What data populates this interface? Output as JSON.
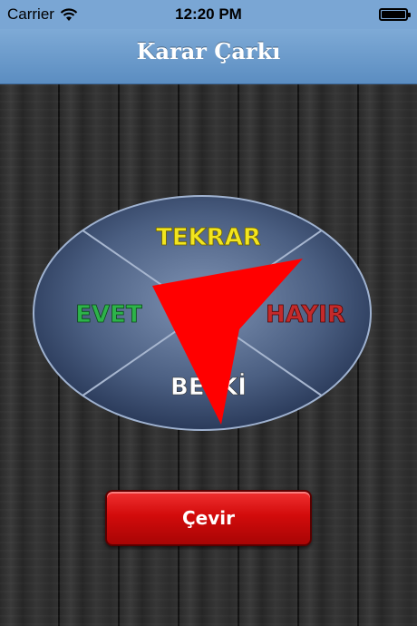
{
  "status_bar": {
    "carrier": "Carrier",
    "time": "12:20 PM",
    "wifi_icon": "wifi-icon",
    "battery_icon": "battery-icon"
  },
  "nav": {
    "title": "Karar Çarkı"
  },
  "wheel": {
    "segments": {
      "top": "TEKRAR",
      "left": "EVET",
      "right": "HAYIR",
      "bottom": "BELKİ"
    },
    "colors": {
      "top": "#f2e51e",
      "left": "#2db34a",
      "right": "#c42a2a",
      "bottom": "#ffffff",
      "pointer": "#ff0000"
    }
  },
  "actions": {
    "spin_label": "Çevir"
  }
}
